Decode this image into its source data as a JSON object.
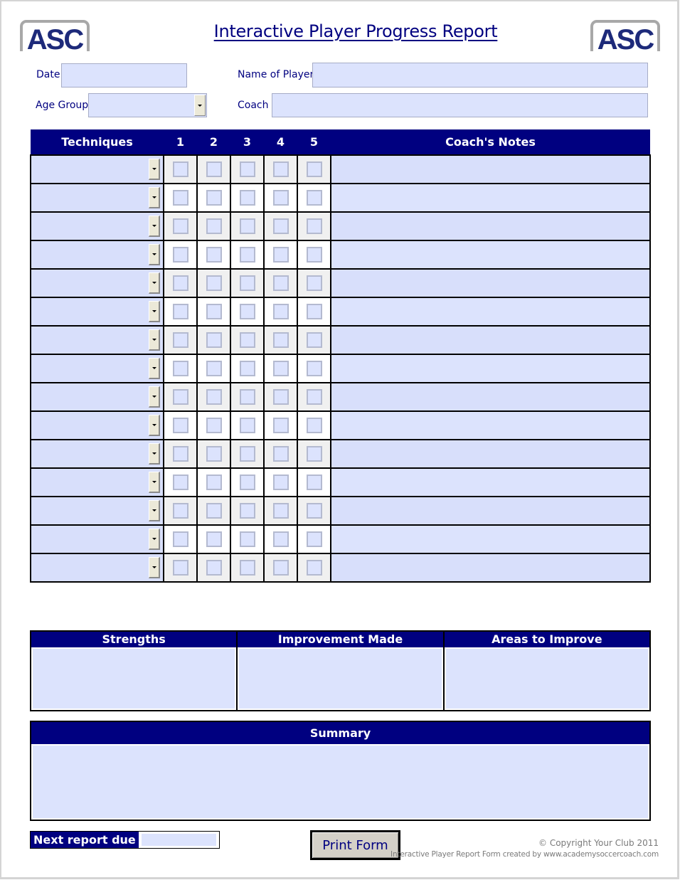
{
  "header": {
    "title": "Interactive Player Progress Report",
    "logo_left_text": "ASC",
    "logo_right_text": "ASC"
  },
  "colors": {
    "header_bg": "#000080",
    "field_bg": "#dce3fd",
    "text": "#000080",
    "button_bg": "#d4d0c8"
  },
  "fields": {
    "date": {
      "label": "Date",
      "value": ""
    },
    "age_group": {
      "label": "Age Group",
      "value": ""
    },
    "player_name": {
      "label": "Name of Player",
      "value": ""
    },
    "coach": {
      "label": "Coach",
      "value": ""
    }
  },
  "techniques_table": {
    "headers": {
      "techniques": "Techniques",
      "ratings": [
        "1",
        "2",
        "3",
        "4",
        "5"
      ],
      "notes": "Coach's Notes"
    },
    "rows": [
      {
        "technique": "",
        "rating": null,
        "notes": ""
      },
      {
        "technique": "",
        "rating": null,
        "notes": ""
      },
      {
        "technique": "",
        "rating": null,
        "notes": ""
      },
      {
        "technique": "",
        "rating": null,
        "notes": ""
      },
      {
        "technique": "",
        "rating": null,
        "notes": ""
      },
      {
        "technique": "",
        "rating": null,
        "notes": ""
      },
      {
        "technique": "",
        "rating": null,
        "notes": ""
      },
      {
        "technique": "",
        "rating": null,
        "notes": ""
      },
      {
        "technique": "",
        "rating": null,
        "notes": ""
      },
      {
        "technique": "",
        "rating": null,
        "notes": ""
      },
      {
        "technique": "",
        "rating": null,
        "notes": ""
      },
      {
        "technique": "",
        "rating": null,
        "notes": ""
      },
      {
        "technique": "",
        "rating": null,
        "notes": ""
      },
      {
        "technique": "",
        "rating": null,
        "notes": ""
      },
      {
        "technique": "",
        "rating": null,
        "notes": ""
      }
    ]
  },
  "assessment": {
    "strengths": {
      "label": "Strengths",
      "value": ""
    },
    "improvement_made": {
      "label": "Improvement Made",
      "value": ""
    },
    "areas_to_improve": {
      "label": "Areas to Improve",
      "value": ""
    }
  },
  "summary": {
    "label": "Summary",
    "value": ""
  },
  "next_report": {
    "label": "Next report due",
    "value": ""
  },
  "actions": {
    "print_label": "Print Form"
  },
  "footer": {
    "copyright": "© Copyright Your Club 2011",
    "credit": "Interactive Player Report Form created by www.academysoccercoach.com"
  }
}
